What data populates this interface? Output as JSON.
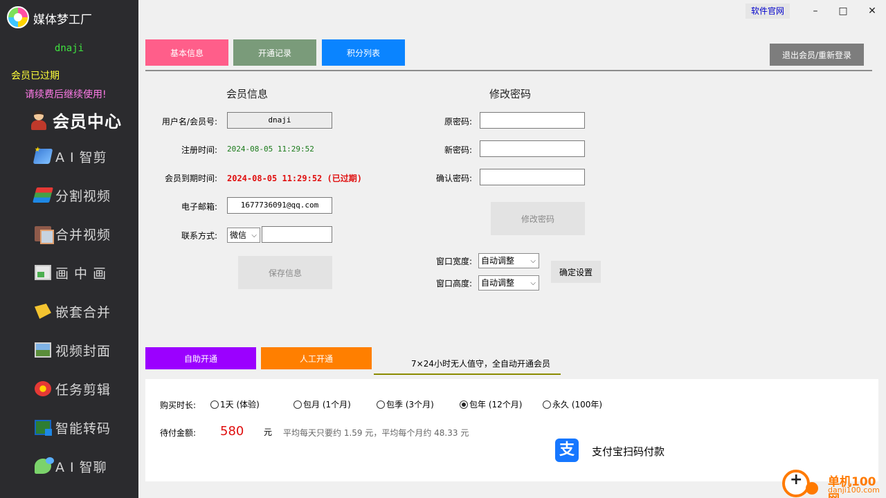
{
  "app": {
    "title": "媒体梦工厂",
    "username": "dnaji",
    "expired": "会员已过期",
    "renew_notice": "请续费后继续使用!",
    "member_center": "会员中心"
  },
  "titlebar": {
    "official_site": "软件官网",
    "minimize": "–",
    "maximize": "□",
    "close": "✕"
  },
  "nav": [
    {
      "label": "A I 智剪",
      "icon": "ai-edit-icon"
    },
    {
      "label": "分割视频",
      "icon": "split-video-icon"
    },
    {
      "label": "合并视频",
      "icon": "merge-video-icon"
    },
    {
      "label": "画 中 画",
      "icon": "picture-in-picture-icon"
    },
    {
      "label": "嵌套合并",
      "icon": "nested-merge-icon"
    },
    {
      "label": "视频封面",
      "icon": "video-cover-icon"
    },
    {
      "label": "任务剪辑",
      "icon": "task-edit-icon"
    },
    {
      "label": "智能转码",
      "icon": "smart-transcode-icon"
    },
    {
      "label": "A I 智聊",
      "icon": "ai-chat-icon"
    }
  ],
  "tabs": {
    "basic": "基本信息",
    "record": "开通记录",
    "points": "积分列表",
    "logout": "退出会员/重新登录"
  },
  "member_info": {
    "title": "会员信息",
    "username_label": "用户名/会员号:",
    "username_value": "dnaji",
    "reg_label": "注册时间:",
    "reg_value": "2024-08-05 11:29:52",
    "expire_label": "会员到期时间:",
    "expire_value": "2024-08-05 11:29:52 (已过期)",
    "email_label": "电子邮箱:",
    "email_value": "1677736091@qq.com",
    "contact_label": "联系方式:",
    "contact_type": "微信",
    "contact_value": "",
    "save_button": "保存信息"
  },
  "password": {
    "title": "修改密码",
    "old_label": "原密码:",
    "new_label": "新密码:",
    "confirm_label": "确认密码:",
    "submit": "修改密码",
    "width_label": "窗口宽度:",
    "width_value": "自动调整",
    "height_label": "窗口高度:",
    "height_value": "自动调整",
    "apply": "确定设置"
  },
  "purchase": {
    "tab_self": "自助开通",
    "tab_manual": "人工开通",
    "note": "7×24小时无人值守，全自动开通会员",
    "duration_label": "购买时长:",
    "options": [
      {
        "label": "1天 (体验)",
        "checked": false
      },
      {
        "label": "包月 (1个月)",
        "checked": false
      },
      {
        "label": "包季 (3个月)",
        "checked": false
      },
      {
        "label": "包年 (12个月)",
        "checked": true
      },
      {
        "label": "永久 (100年)",
        "checked": false
      }
    ],
    "amount_label": "待付金额:",
    "amount": "580",
    "unit": "元",
    "average": "平均每天只要约 1.59 元，平均每个月约 48.33 元",
    "alipay_glyph": "支",
    "alipay_text": "支付宝扫码付款"
  },
  "watermark": {
    "title": "单机100网",
    "url": "danji100.com"
  },
  "colors": {
    "sidebar_bg": "#2b2b2e",
    "username_green": "#3fe03f",
    "expired_yellow": "#ffff3a",
    "renew_pink": "#ff7be8",
    "tab_basic": "#ff5e8a",
    "tab_record": "#7a9b7a",
    "tab_points": "#0a84ff",
    "tab_self": "#9b00ff",
    "tab_manual": "#ff7f00",
    "amount_red": "#e01010",
    "alipay_blue": "#1677ff"
  }
}
